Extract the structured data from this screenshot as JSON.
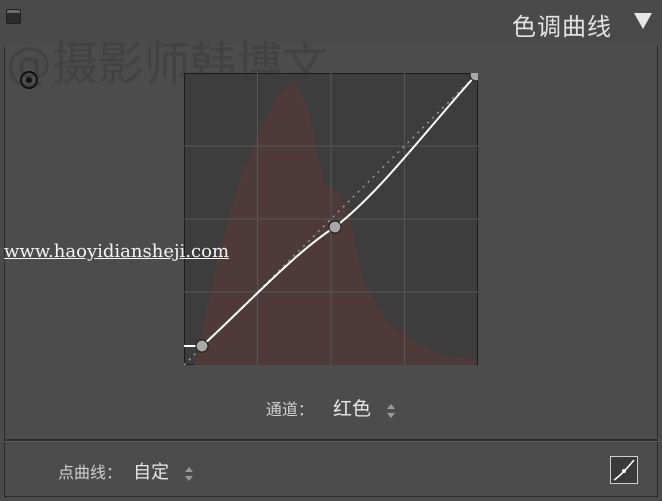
{
  "panel": {
    "title": "色调曲线"
  },
  "watermarks": {
    "author": "@摄影师韩博文",
    "url": "www.haoyidiansheji.com"
  },
  "channel": {
    "label": "通道：",
    "value": "红色"
  },
  "point_curve": {
    "label": "点曲线：",
    "value": "自定"
  },
  "colors": {
    "panel_bg": "#4b4b4b",
    "graph_bg": "#3d3d3d",
    "histogram": "#4f3a38",
    "curve": "#ffffff",
    "control_point": "#a8a8a8"
  },
  "icons": {
    "collapse": "collapse-toggle-icon",
    "disclosure": "triangle-down-icon",
    "target_adjust": "target-adjust-icon",
    "point_curve_toggle": "point-curve-icon"
  }
}
